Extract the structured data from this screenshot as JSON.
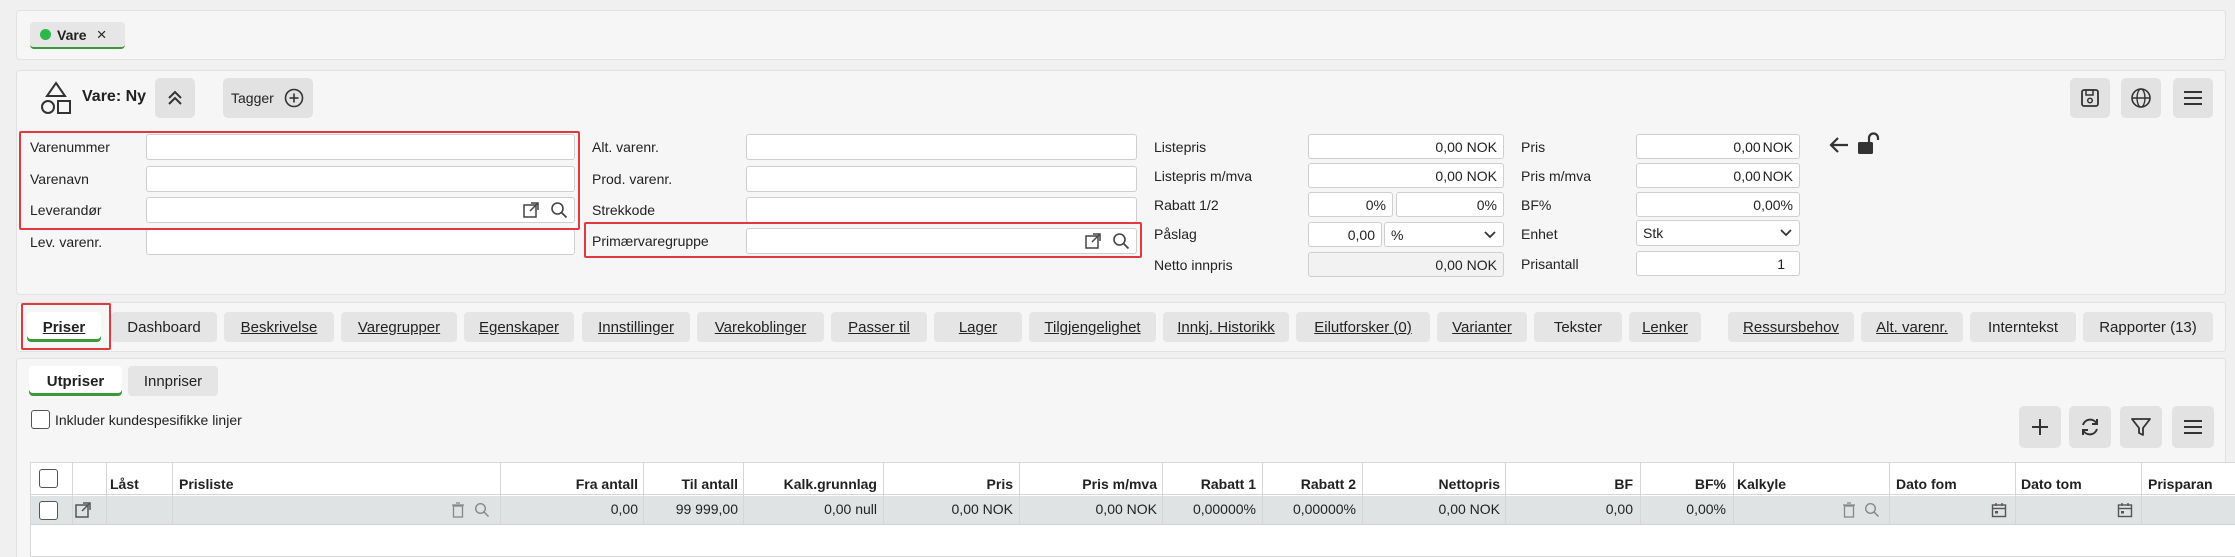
{
  "doc_tab": {
    "label": "Vare",
    "close": "×"
  },
  "header": {
    "title": "Vare: Ny",
    "tagger_label": "Tagger"
  },
  "form": {
    "col1": [
      {
        "label": "Varenummer",
        "value": ""
      },
      {
        "label": "Varenavn",
        "value": ""
      },
      {
        "label": "Leverandør",
        "value": ""
      },
      {
        "label": "Lev. varenr.",
        "value": ""
      }
    ],
    "col2": [
      {
        "label": "Alt. varenr.",
        "value": ""
      },
      {
        "label": "Prod. varenr.",
        "value": ""
      },
      {
        "label": "Strekkode",
        "value": ""
      },
      {
        "label": "Primærvaregruppe",
        "value": ""
      }
    ],
    "col3": {
      "listepris": {
        "label": "Listepris",
        "value": "0,00",
        "unit": "NOK"
      },
      "listepris_mva": {
        "label": "Listepris m/mva",
        "value": "0,00",
        "unit": "NOK"
      },
      "rabatt": {
        "label": "Rabatt 1/2",
        "value1": "0%",
        "value2": "0%"
      },
      "paslag": {
        "label": "Påslag",
        "value": "0,00",
        "unit_select": "%"
      },
      "netto": {
        "label": "Netto innpris",
        "value": "0,00",
        "unit": "NOK"
      }
    },
    "col4": {
      "pris": {
        "label": "Pris",
        "value": "0,00",
        "unit": "NOK"
      },
      "pris_mva": {
        "label": "Pris m/mva",
        "value": "0,00",
        "unit": "NOK"
      },
      "bf": {
        "label": "BF%",
        "value": "0,00%"
      },
      "enhet": {
        "label": "Enhet",
        "value": "Stk"
      },
      "prisantall": {
        "label": "Prisantall",
        "value": "1"
      }
    }
  },
  "tabs": [
    {
      "label": "Priser",
      "active": true
    },
    {
      "label": "Dashboard"
    },
    {
      "label": "Beskrivelse"
    },
    {
      "label": "Varegrupper"
    },
    {
      "label": "Egenskaper"
    },
    {
      "label": "Innstillinger"
    },
    {
      "label": "Varekoblinger"
    },
    {
      "label": "Passer til"
    },
    {
      "label": "Lager"
    },
    {
      "label": "Tilgjengelighet"
    },
    {
      "label": "Innkj. Historikk"
    },
    {
      "label": "Eilutforsker (0)"
    },
    {
      "label": "Varianter"
    },
    {
      "label": "Tekster"
    },
    {
      "label": "Lenker"
    },
    {
      "label": "Ressursbehov"
    },
    {
      "label": "Alt. varenr."
    },
    {
      "label": "Interntekst"
    },
    {
      "label": "Rapporter (13)"
    }
  ],
  "subtabs": [
    {
      "label": "Utpriser",
      "active": true
    },
    {
      "label": "Innpriser"
    }
  ],
  "filter_checkbox_label": "Inkluder kundespesifikke linjer",
  "table": {
    "headers": [
      "Låst",
      "Prisliste",
      "Fra antall",
      "Til antall",
      "Kalk.grunnlag",
      "Pris",
      "Pris m/mva",
      "Rabatt 1",
      "Rabatt 2",
      "Nettopris",
      "BF",
      "BF%",
      "Kalkyle",
      "Dato fom",
      "Dato tom",
      "Prisparan"
    ],
    "row": {
      "fra_antall": "0,00",
      "til_antall": "99 999,00",
      "kalk": "0,00 null",
      "pris": "0,00 NOK",
      "pris_mva": "0,00 NOK",
      "rabatt1": "0,00000%",
      "rabatt2": "0,00000%",
      "nettopris": "0,00 NOK",
      "bf": "0,00",
      "bfp": "0,00%"
    }
  },
  "colors": {
    "accent_green": "#3a9a3a",
    "highlight_red": "#e0393e",
    "status_dot": "#2db84a"
  }
}
